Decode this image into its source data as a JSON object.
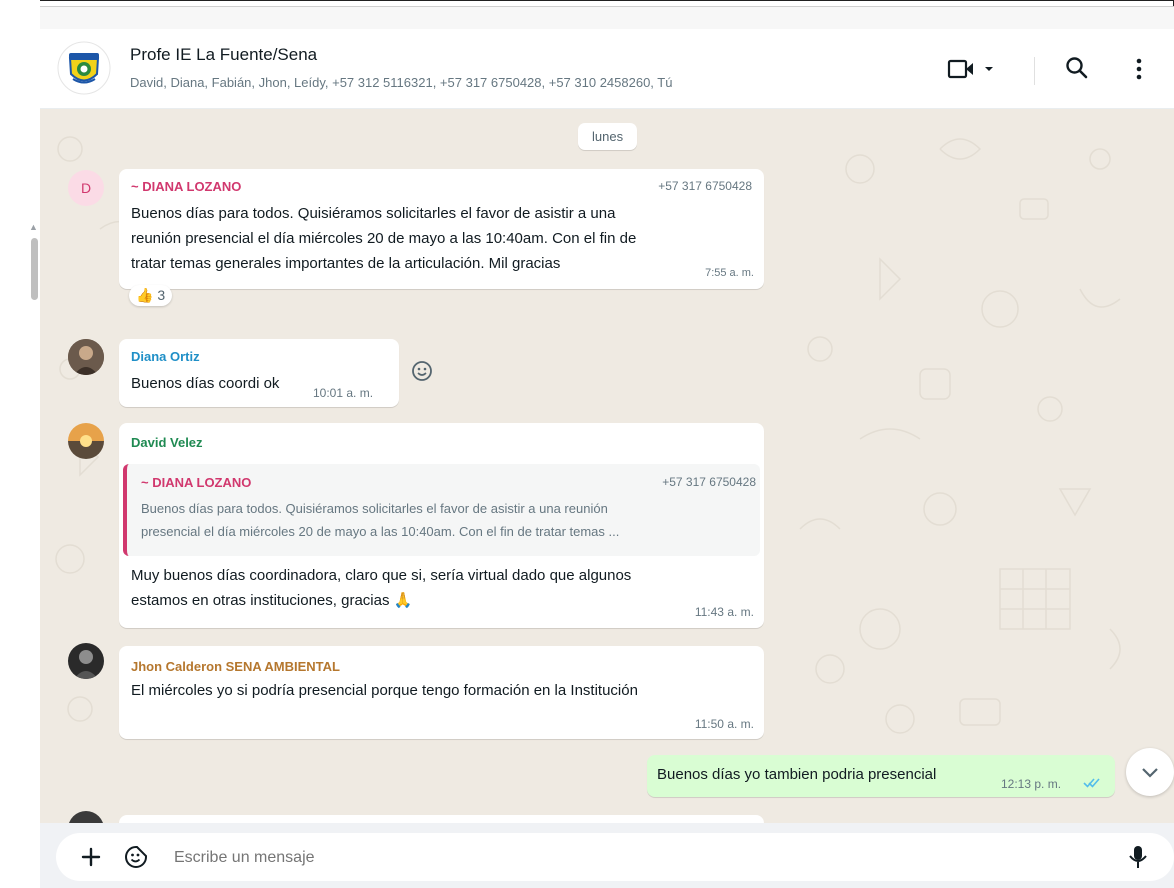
{
  "chat_header": {
    "title": "Profe IE La Fuente/Sena",
    "participants": "David, Diana, Fabián, Jhon, Leídy, +57 312 5116321, +57 317 6750428, +57 310 2458260, Tú"
  },
  "date_divider": "lunes",
  "messages": [
    {
      "avatar_letter": "D",
      "sender": "~ DIANA LOZANO",
      "phone": "+57 317 6750428",
      "lines": [
        "Buenos días para todos. Quisiéramos solicitarles el favor de asistir a una",
        "reunión presencial el día miércoles 20 de mayo a las 10:40am. Con el fin de",
        "tratar temas generales importantes de la articulación. Mil gracias"
      ],
      "time": "7:55 a. m.",
      "reaction": {
        "emoji": "👍",
        "count": "3"
      }
    },
    {
      "sender": "Diana Ortiz",
      "text": "Buenos días coordi ok",
      "time": "10:01 a. m."
    },
    {
      "sender": "David Velez",
      "quote": {
        "sender": "~ DIANA LOZANO",
        "phone": "+57 317 6750428",
        "line1": "Buenos días para todos. Quisiéramos solicitarles el favor de asistir a una reunión",
        "line2": "presencial el día miércoles 20 de mayo a las 10:40am. Con el fin de tratar temas ..."
      },
      "line1": "Muy buenos días coordinadora, claro que si, sería virtual dado que algunos",
      "line2": "estamos en otras instituciones, gracias 🙏",
      "time": "11:43 a. m."
    },
    {
      "sender": "Jhon Calderon SENA AMBIENTAL",
      "text": "El miércoles yo si podría presencial porque tengo formación en la Institución",
      "time": "11:50 a. m."
    },
    {
      "outgoing": true,
      "text": "Buenos días yo tambien podria presencial",
      "time": "12:13 p. m.",
      "status": "double-check-read"
    }
  ],
  "composer": {
    "placeholder": "Escribe un mensaje"
  },
  "colors": {
    "chat_bg": "#efeae2",
    "outgoing_bubble": "#d9fdd3",
    "diana_lozano": "#d1386e",
    "diana_ortiz": "#1f8fc7",
    "david_velez": "#1f8a52",
    "jhon_calderon": "#b5772e",
    "read_ticks": "#53bdeb"
  }
}
